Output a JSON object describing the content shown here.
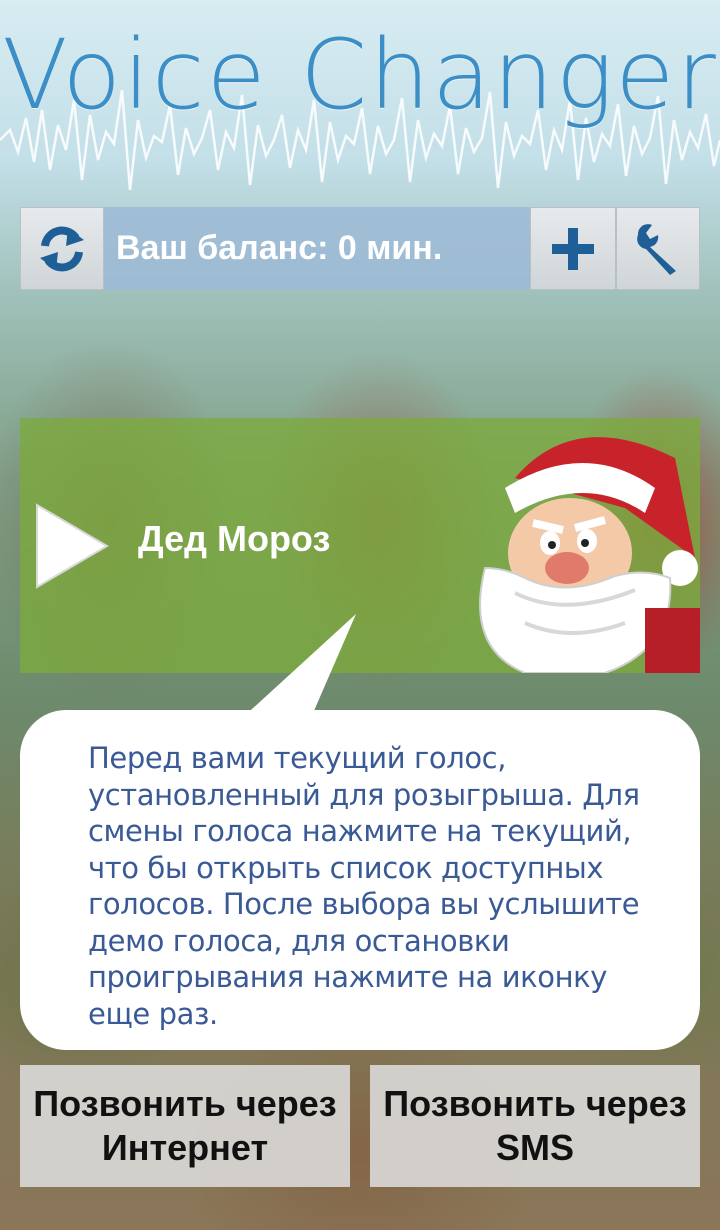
{
  "app": {
    "title": "Voice Changer"
  },
  "toolbar": {
    "refresh_icon": "refresh-icon",
    "balance_text": "Ваш баланс: 0 мин.",
    "add_icon": "plus-icon",
    "settings_icon": "wrench-icon"
  },
  "voice": {
    "name": "Дед Мороз",
    "play_icon": "play-icon",
    "avatar": "santa-claus-avatar"
  },
  "tooltip": {
    "text": "Перед вами текущий голос, установленный для розыгрыша. Для смены голоса нажмите на текущий, что бы открыть список доступных голосов. После выбора вы услышите демо голоса, для остановки проигрывания нажмите на иконку еще раз."
  },
  "buttons": {
    "call_internet_line1": "Позвонить через",
    "call_internet_line2": "Интернет",
    "call_sms_line1": "Позвонить через",
    "call_sms_line2": "SMS"
  },
  "colors": {
    "title": "#3b8ec6",
    "balance_bg": "#9cbad6",
    "voice_card_bg": "#7caa3c",
    "tooltip_text": "#3a5a96",
    "icon_blue": "#1f5f98"
  }
}
